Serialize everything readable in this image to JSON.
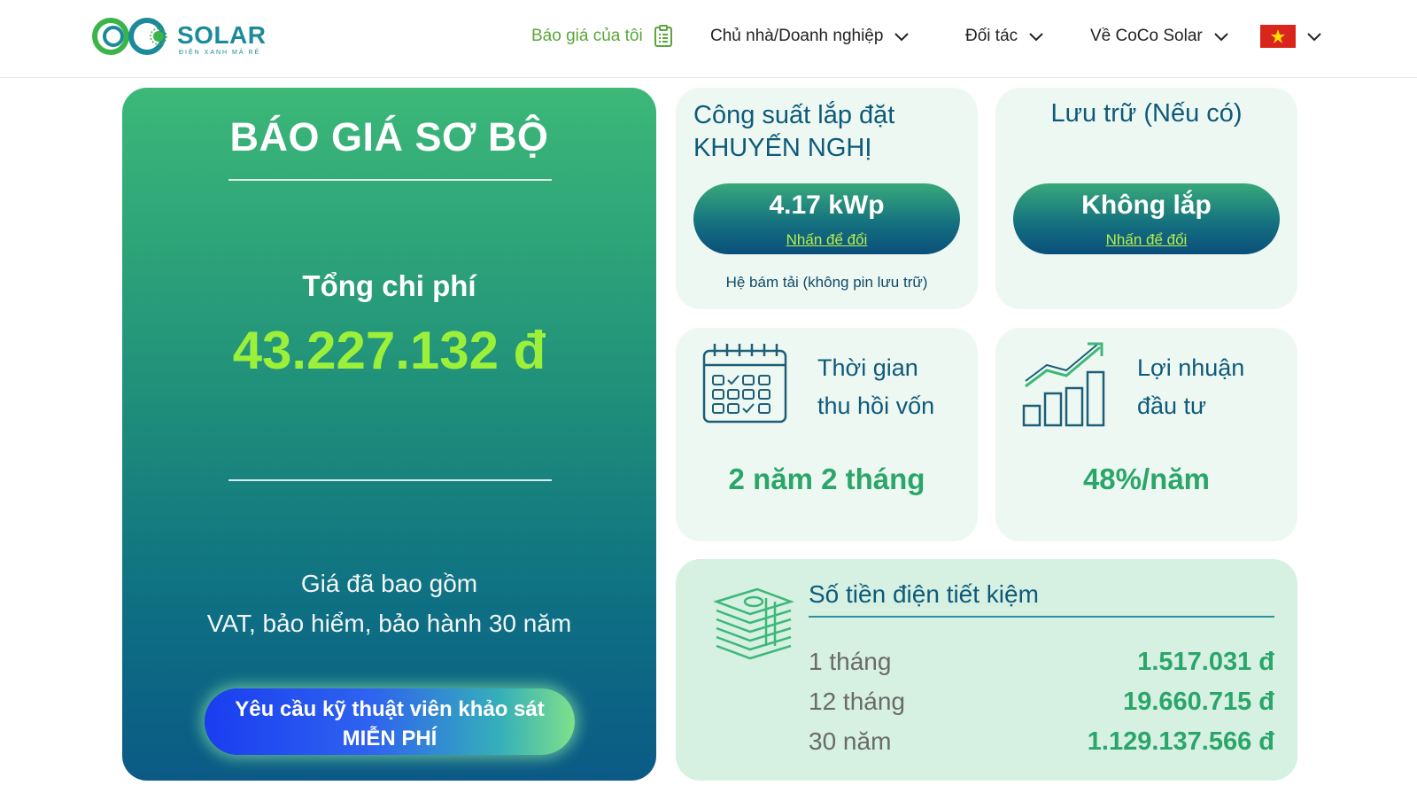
{
  "header": {
    "logo_text": "SOLAR",
    "logo_tagline": "ĐIỆN XANH MÀ RẺ",
    "nav": {
      "my_quote": "Báo giá của tôi",
      "owner": "Chủ nhà/Doanh nghiệp",
      "partner": "Đối tác",
      "about": "Về CoCo Solar"
    }
  },
  "quote": {
    "title": "BÁO GIÁ SƠ BỘ",
    "total_label": "Tổng chi phí",
    "total_value": "43.227.132 đ",
    "included_line1": "Giá đã bao gồm",
    "included_line2": "VAT, bảo hiểm, bảo hành 30 năm",
    "survey_line1": "Yêu cầu kỹ thuật viên khảo sát",
    "survey_line2": "MIỄN PHÍ"
  },
  "power": {
    "title": "Công suất lắp đặt KHUYẾN NGHỊ",
    "value": "4.17 kWp",
    "change_link": "Nhấn để đổi",
    "note": "Hệ bám tải (không pin lưu trữ)"
  },
  "storage": {
    "title": "Lưu trữ (Nếu có)",
    "value": "Không lắp",
    "change_link": "Nhấn để đổi"
  },
  "payback": {
    "label_line1": "Thời gian",
    "label_line2": "thu hồi vốn",
    "value": "2 năm 2 tháng"
  },
  "profit": {
    "label_line1": "Lợi nhuận",
    "label_line2": "đầu tư",
    "value": "48%/năm"
  },
  "savings": {
    "title": "Số tiền điện tiết kiệm",
    "rows": [
      {
        "period": "1 tháng",
        "amount": "1.517.031 đ"
      },
      {
        "period": "12 tháng",
        "amount": "19.660.715 đ"
      },
      {
        "period": "30 năm",
        "amount": "1.129.137.566 đ"
      }
    ]
  },
  "colors": {
    "brand_green": "#5aa63a",
    "accent_lime": "#9df03a",
    "text_blue": "#0e5a7a",
    "value_green": "#2aa66a"
  }
}
